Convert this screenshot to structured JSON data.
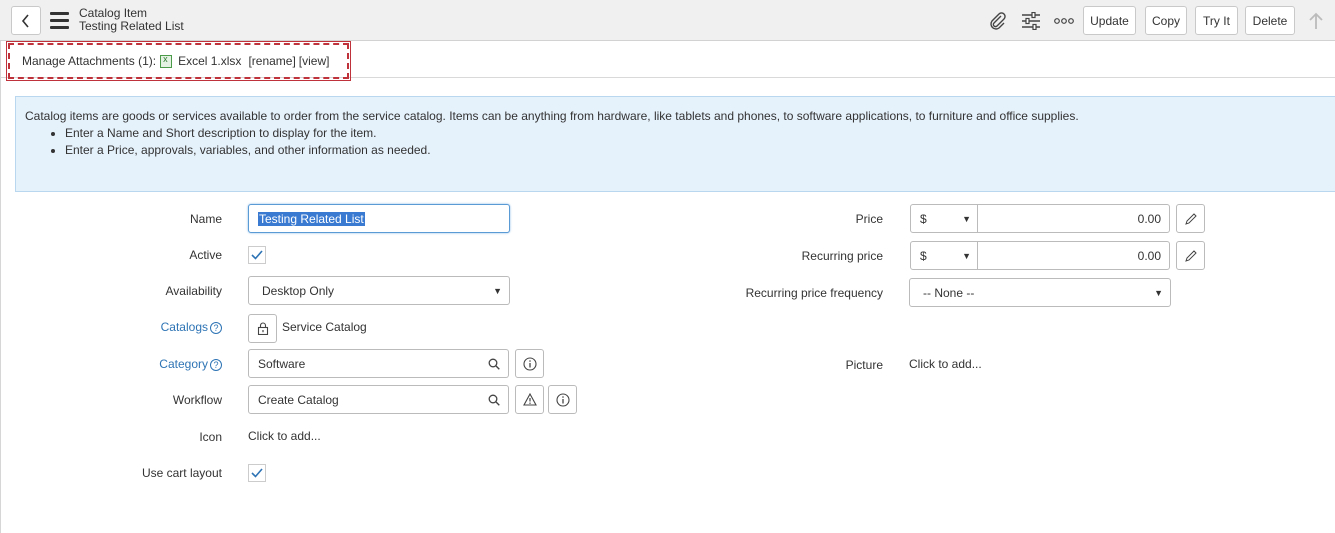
{
  "header": {
    "title": "Catalog Item",
    "subtitle": "Testing Related List",
    "buttons": {
      "update": "Update",
      "copy": "Copy",
      "try_it": "Try It",
      "delete": "Delete"
    },
    "icons": [
      "back-icon",
      "menu-icon",
      "paperclip-icon",
      "settings-sliders-icon",
      "more-options-icon",
      "scroll-top-icon"
    ]
  },
  "attachments": {
    "label": "Manage Attachments (1):",
    "file_name": "Excel 1.xlsx",
    "rename": "[rename]",
    "view": "[view]"
  },
  "info": {
    "text": "Catalog items are goods or services available to order from the service catalog. Items can be anything from hardware, like tablets and phones, to software applications, to furniture and office supplies.",
    "bullets": [
      "Enter a Name and Short description to display for the item.",
      "Enter a Price, approvals, variables, and other information as needed."
    ]
  },
  "form": {
    "name": {
      "label": "Name",
      "value": "Testing Related List"
    },
    "active": {
      "label": "Active",
      "checked": true
    },
    "availability": {
      "label": "Availability",
      "value": "Desktop Only"
    },
    "catalogs": {
      "label": "Catalogs",
      "value": "Service Catalog"
    },
    "category": {
      "label": "Category",
      "value": "Software"
    },
    "workflow": {
      "label": "Workflow",
      "value": "Create Catalog"
    },
    "icon": {
      "label": "Icon",
      "value": "Click to add..."
    },
    "use_cart_layout": {
      "label": "Use cart layout",
      "checked": true
    },
    "price": {
      "label": "Price",
      "currency": "$",
      "value": "0.00"
    },
    "recurring_price": {
      "label": "Recurring price",
      "currency": "$",
      "value": "0.00"
    },
    "recurring_frequency": {
      "label": "Recurring price frequency",
      "value": "-- None --"
    },
    "picture": {
      "label": "Picture",
      "value": "Click to add..."
    }
  },
  "colors": {
    "header_bg": "#f0f0f0",
    "info_bg": "#e5f1fb",
    "link": "#2e74b5",
    "highlight_border": "#c0323b",
    "selection": "#3a7ad1"
  }
}
